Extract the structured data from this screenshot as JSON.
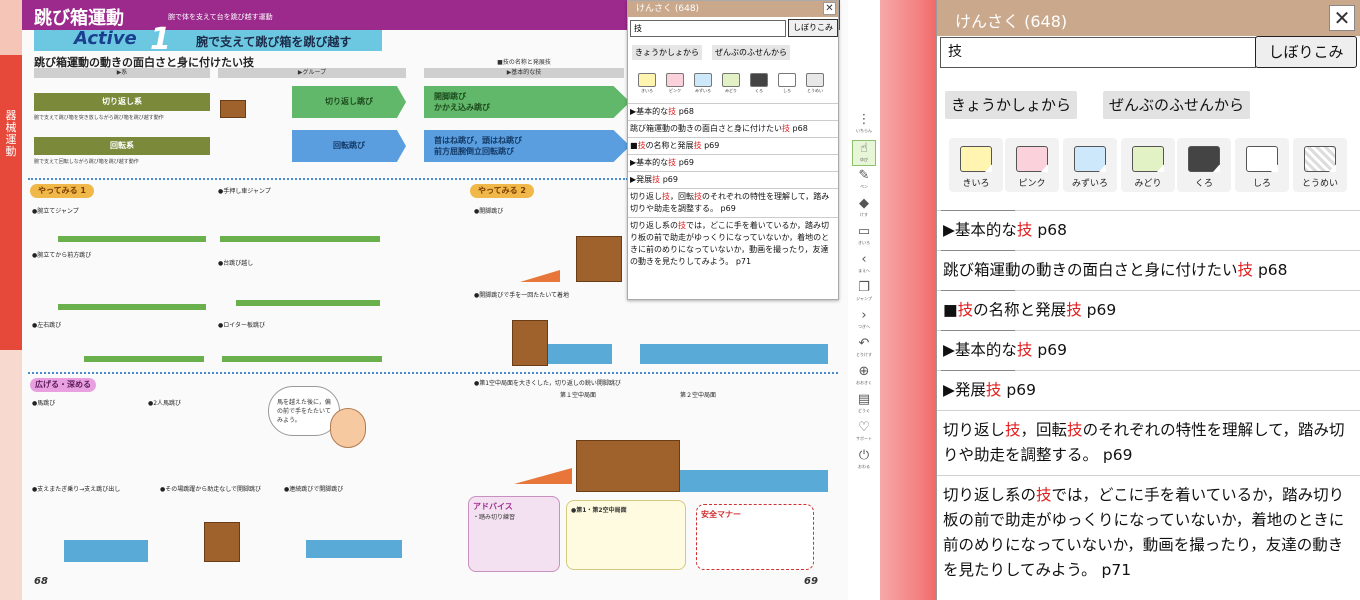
{
  "book": {
    "section_title": "跳び箱運動",
    "section_sub": "腕で体を支えて台を跳び越す運動",
    "edge_tab": "器械運動",
    "active_word": "Active",
    "active_num": "1",
    "active_text": "腕で支えて跳び箱を跳び越す",
    "subhead": "跳び箱運動の動きの面白さと身に付けたい技",
    "cat_heads": [
      "▶系",
      "▶グループ",
      "■技の名称と発展技",
      "▶基本的な技"
    ],
    "rows": [
      {
        "cat": "切り返し系",
        "note": "腕で支えて跳び箱を突き放しながら跳び箱を跳び越す動作",
        "group": "切り返し跳び",
        "tech": "開脚跳び\nかかえ込み跳び"
      },
      {
        "cat": "回転系",
        "note": "腕で支えて回転しながら跳び箱を跳び越す動作",
        "group": "回転跳び",
        "tech": "首はね跳び，頭はね跳び\n前方屈腕倒立回転跳び"
      }
    ],
    "badge_try1": "やってみる 1",
    "badge_try2": "やってみる 2",
    "badge_expand": "広げる・深める",
    "labels_left": [
      "●腕立てジャンプ",
      "●腕立てから前方跳び",
      "●左右跳び",
      "●手押し車ジャンプ",
      "●台跳び越し",
      "●ロイター板跳び",
      "●馬跳び",
      "●2人馬跳び",
      "●支えまたぎ乗り→支え跳び出し",
      "●その場跳躍から助走なしで開脚跳び",
      "●連続跳びで開脚跳び"
    ],
    "labels_right": [
      "●開脚跳び",
      "●開脚跳びで手を一回たたいて着地",
      "●第1空中局面を大きくした，切り返しの鋭い開脚跳び",
      "第１空中局面",
      "第２空中局面"
    ],
    "bubble": "馬を越えた後に，偏の前で手をたたいてみよう。",
    "advice_title": "アドバイス",
    "advice_text": "・踏み切り練習",
    "knowledge_title": "●第1・第2空中局面",
    "safety_title": "安全マナー",
    "page_left": "68",
    "page_right": "69"
  },
  "minipop": {
    "title": "けんさく (648)",
    "close": "✕",
    "query": "技",
    "filter_label": "しぼりこみ",
    "btn_textbook": "きょうかしょから",
    "btn_sticky": "ぜんぶのふせんから",
    "colors": [
      "きいろ",
      "ピンク",
      "みずいろ",
      "みどり",
      "くろ",
      "しろ",
      "とうめい"
    ]
  },
  "toolbar": [
    {
      "name": "いちらん",
      "icon": "⋮"
    },
    {
      "name": "ゆび",
      "icon": "☝"
    },
    {
      "name": "ペン",
      "icon": "✎"
    },
    {
      "name": "けす",
      "icon": "◆"
    },
    {
      "name": "きいろ",
      "icon": "▭"
    },
    {
      "name": "まえへ",
      "icon": "‹"
    },
    {
      "name": "ジャンプ",
      "icon": "❐"
    },
    {
      "name": "つぎへ",
      "icon": "›"
    },
    {
      "name": "とりけす",
      "icon": "↶"
    },
    {
      "name": "おおきく",
      "icon": "⊕"
    },
    {
      "name": "どうぐ",
      "icon": "▤"
    },
    {
      "name": "サポート",
      "icon": "♡"
    },
    {
      "name": "おわる",
      "icon": "⏻"
    }
  ],
  "panel": {
    "title": "けんさく (648)",
    "close": "✕",
    "query": "技",
    "filter_label": "しぼりこみ",
    "btn_textbook": "きょうかしょから",
    "btn_sticky": "ぜんぶのふせんから",
    "swatches": [
      {
        "label": "きいろ",
        "color": "#fff4b0"
      },
      {
        "label": "ピンク",
        "color": "#fbd2dc"
      },
      {
        "label": "みずいろ",
        "color": "#cde8fb"
      },
      {
        "label": "みどり",
        "color": "#e2f2c4"
      },
      {
        "label": "くろ",
        "color": "#444444"
      },
      {
        "label": "しろ",
        "color": "#ffffff"
      },
      {
        "label": "とうめい",
        "color": "#e8e8e8"
      }
    ],
    "results": [
      {
        "before": "▶基本的な",
        "hit": "技",
        "after": " p68"
      },
      {
        "before": "跳び箱運動の動きの面白さと身に付けたい",
        "hit": "技",
        "after": " p68"
      },
      {
        "before": "■",
        "hit": "技",
        "after": "の名称と発展技 p69",
        "hit2_pre": "の名称と発展",
        "hit2": "技",
        "hit2_post": " p69"
      },
      {
        "before": "▶基本的な",
        "hit": "技",
        "after": " p69"
      },
      {
        "before": "▶発展",
        "hit": "技",
        "after": " p69"
      },
      {
        "parts": [
          "切り返し",
          "技",
          "，回転",
          "技",
          "のそれぞれの特性を理解して，踏み切りや助走を調整する。 p69"
        ]
      },
      {
        "parts": [
          "切り返し系の",
          "技",
          "では，どこに手を着いているか，踏み切り板の前で助走がゆっくりになっていないか，着地のときに前のめりになっていないか，動画を撮ったり，友達の動きを見たりしてみよう。 p71"
        ]
      }
    ]
  }
}
